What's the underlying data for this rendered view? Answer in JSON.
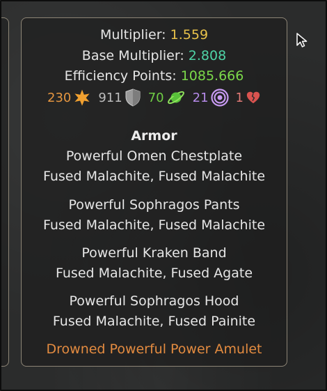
{
  "stats_top": {
    "multiplier_label": "Multiplier:",
    "multiplier_value": "1.559",
    "base_multiplier_label": "Base Multiplier:",
    "base_multiplier_value": "2.808",
    "efficiency_label": "Efficiency Points:",
    "efficiency_value": "1085.666"
  },
  "badges": [
    {
      "value": "230",
      "icon": "star-icon",
      "color": "#e59640"
    },
    {
      "value": "911",
      "icon": "shield-icon",
      "color": "#bdbdbd"
    },
    {
      "value": "70",
      "icon": "planet-icon",
      "color": "#6fce45"
    },
    {
      "value": "21",
      "icon": "target-icon",
      "color": "#b58ae8"
    },
    {
      "value": "1",
      "icon": "broken-heart-icon",
      "color": "#e07a76"
    }
  ],
  "armor": {
    "heading": "Armor",
    "items": [
      {
        "name": "Powerful Omen Chestplate",
        "gems": "Fused Malachite, Fused Malachite"
      },
      {
        "name": "Powerful Sophragos Pants",
        "gems": "Fused Malachite, Fused Malachite"
      },
      {
        "name": "Powerful Kraken Band",
        "gems": "Fused Malachite, Fused Agate"
      },
      {
        "name": "Powerful Sophragos Hood",
        "gems": "Fused Malachite, Fused Painite"
      }
    ],
    "amulet": "Drowned Powerful Power Amulet"
  },
  "colors": {
    "multiplier": "#e8c24a",
    "base_multiplier": "#4fd3a6",
    "efficiency": "#7bd94a",
    "amulet": "#e38b40",
    "panel_border": "#8d8576"
  }
}
